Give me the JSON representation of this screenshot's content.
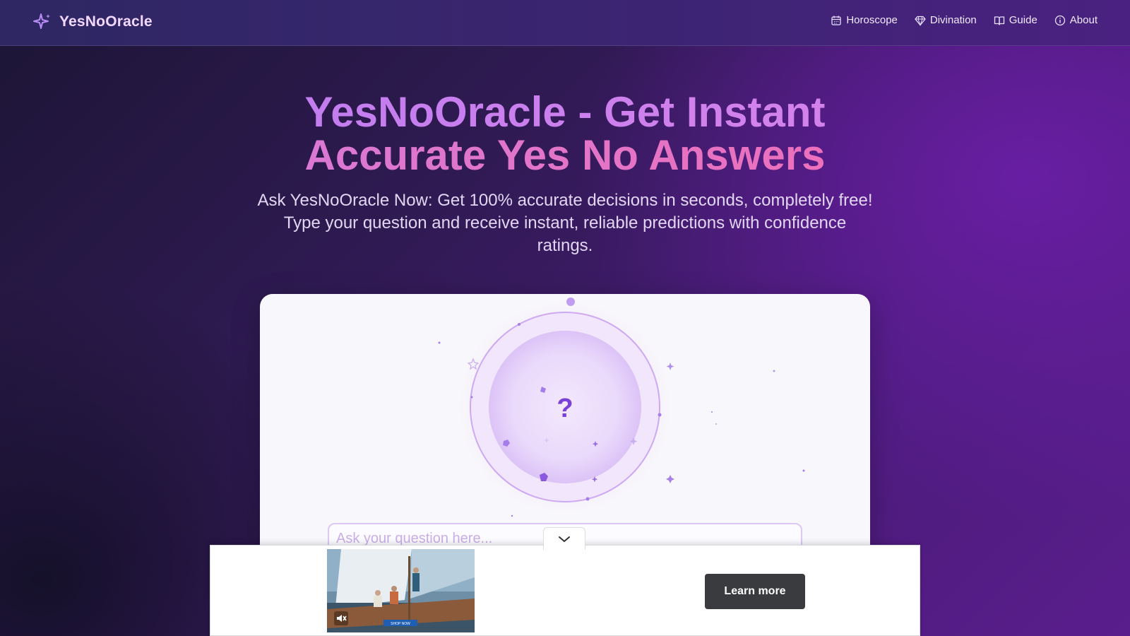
{
  "header": {
    "brand": "YesNoOracle",
    "nav": [
      {
        "label": "Horoscope",
        "icon": "calendar-icon"
      },
      {
        "label": "Divination",
        "icon": "gem-icon"
      },
      {
        "label": "Guide",
        "icon": "book-icon"
      },
      {
        "label": "About",
        "icon": "info-icon"
      }
    ]
  },
  "hero": {
    "title_line1": "YesNoOracle - Get Instant",
    "title_line2": "Accurate Yes No Answers",
    "subtitle": "Ask YesNoOracle Now: Get 100% accurate decisions in seconds, completely free! Type your question and receive instant, reliable predictions with confidence ratings."
  },
  "oracle": {
    "symbol": "?",
    "input_placeholder": "Ask your question here..."
  },
  "ad": {
    "cta_label": "Learn more",
    "video_button_text": "SHOP NOW"
  },
  "colors": {
    "accent": "#7a3fd6",
    "title_pink": "#e86cc6",
    "title_violet": "#c985f2"
  }
}
